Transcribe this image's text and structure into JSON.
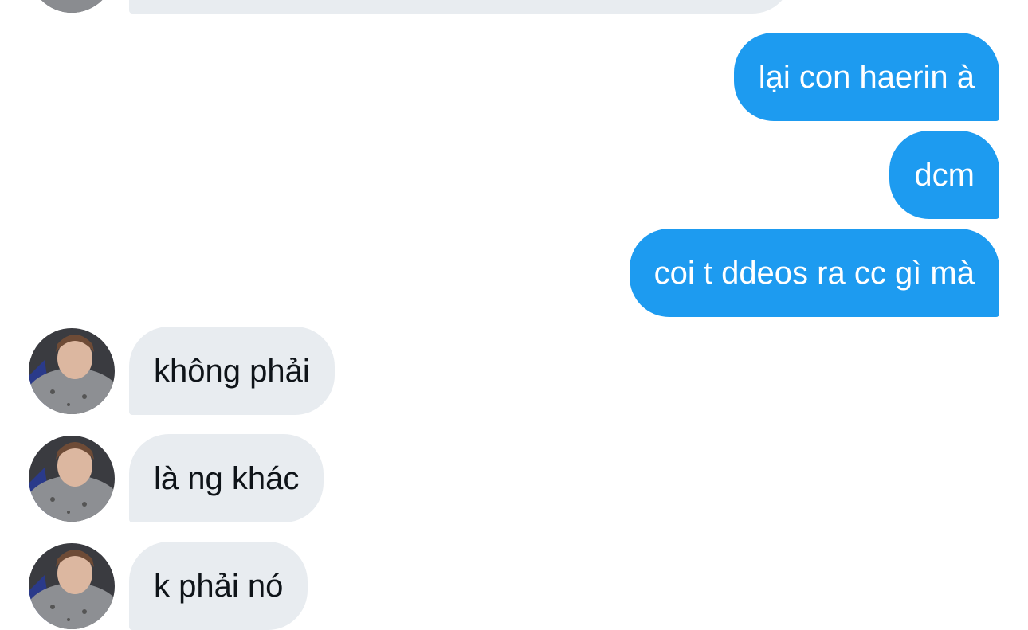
{
  "conversation": {
    "messages": [
      {
        "sender": "contact",
        "text": ""
      },
      {
        "sender": "me",
        "text": "lại con haerin à"
      },
      {
        "sender": "me",
        "text": "dcm"
      },
      {
        "sender": "me",
        "text": "coi t ddeos ra cc gì mà"
      },
      {
        "sender": "contact",
        "text": "không phải"
      },
      {
        "sender": "contact",
        "text": "là ng khác"
      },
      {
        "sender": "contact",
        "text": "k phải nó"
      }
    ]
  },
  "colors": {
    "outgoing_bubble": "#1d9bf0",
    "incoming_bubble": "#e8ecf0",
    "background": "#ffffff"
  },
  "icons": {
    "contact_avatar": "profile-photo-avatar"
  }
}
